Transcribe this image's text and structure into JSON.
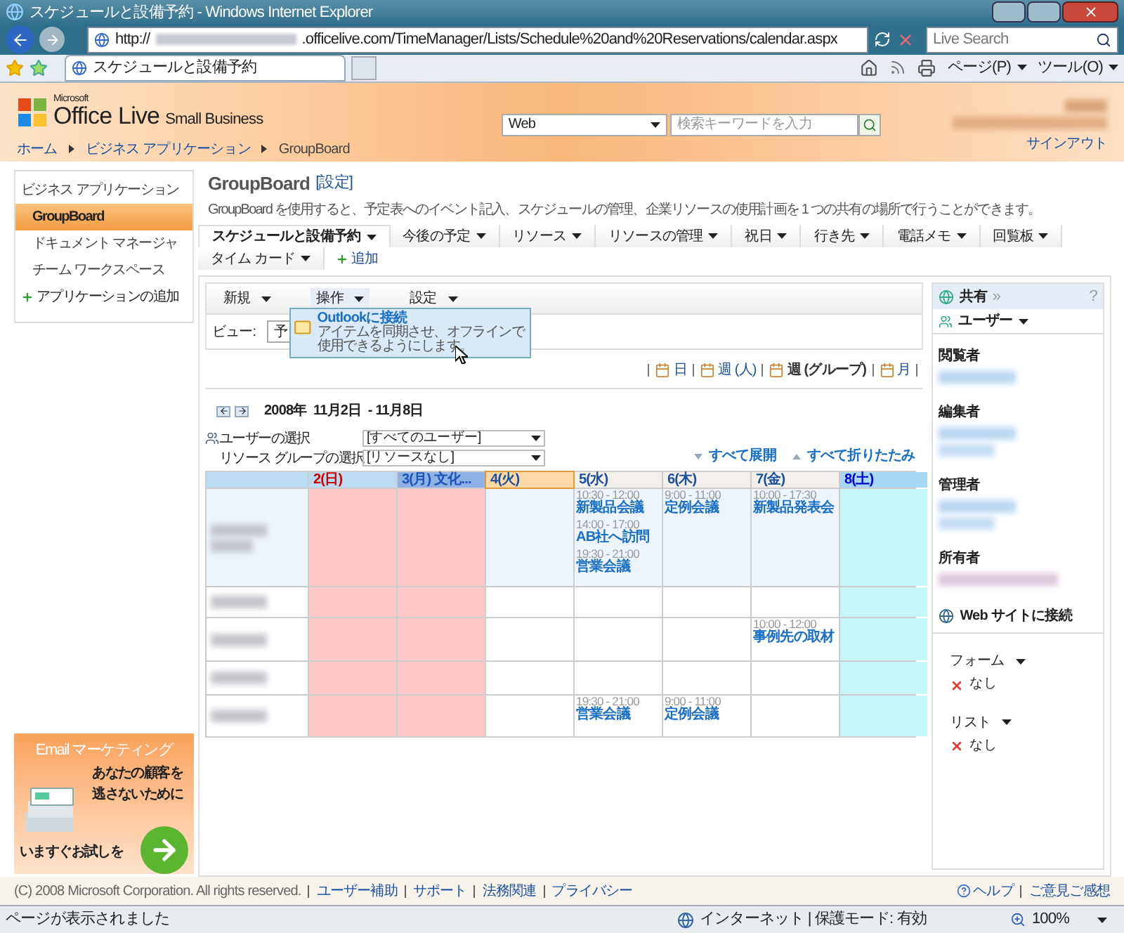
{
  "browser": {
    "title": "スケジュールと設備予約 - Windows Internet Explorer",
    "url_prefix": "http://",
    "url_rest": ".officelive.com/TimeManager/Lists/Schedule%20and%20Reservations/calendar.aspx",
    "search_placeholder": "Live Search",
    "tab": "スケジュールと設備予約",
    "commands": [
      "ページ(P)",
      "ツール(O)"
    ]
  },
  "header": {
    "logo_small": "Microsoft",
    "logo_main": "Office Live",
    "logo_sub": "Small Business",
    "search_scope": "Web",
    "search_placeholder": "検索キーワードを入力",
    "signout": "サインアウト",
    "breadcrumb": [
      "ホーム",
      "ビジネス アプリケーション",
      "GroupBoard"
    ]
  },
  "sidebar": {
    "heading": "ビジネス アプリケーション",
    "items": [
      {
        "label": "GroupBoard",
        "selected": true
      },
      {
        "label": "ドキュメント マネージャ",
        "selected": false
      },
      {
        "label": "チーム ワークスペース",
        "selected": false
      }
    ],
    "add": "アプリケーションの追加",
    "ad": {
      "title": "Email マーケティング",
      "lines": [
        "あなたの顧客を",
        "逃さないために"
      ],
      "cta": "いますぐお試しを"
    }
  },
  "page": {
    "title": "GroupBoard",
    "settings_link": "[設定]",
    "description": "GroupBoard を使用すると、予定表へのイベント記入、スケジュールの管理、企業リソースの使用計画を 1 つの共有の場所で行うことができます。",
    "tabs": [
      [
        {
          "label": "スケジュールと設備予約",
          "selected": true
        },
        {
          "label": "今後の予定",
          "selected": false
        },
        {
          "label": "リソース",
          "selected": false
        },
        {
          "label": "リソースの管理",
          "selected": false
        },
        {
          "label": "祝日",
          "selected": false
        },
        {
          "label": "行き先",
          "selected": false
        },
        {
          "label": "電話メモ",
          "selected": false
        },
        {
          "label": "回覧板",
          "selected": false
        }
      ],
      [
        {
          "label": "タイム カード",
          "selected": false
        }
      ]
    ],
    "add_tab": "追加",
    "toolbar": [
      {
        "label": "新規",
        "open": false
      },
      {
        "label": "操作",
        "open": true
      },
      {
        "label": "設定",
        "open": false
      }
    ],
    "menu": {
      "title": "Outlookに接続",
      "description": "アイテムを同期させ、オフラインで使用できるようにします。"
    },
    "view_label": "ビュー:",
    "view_value": "予",
    "views": [
      {
        "label": "日",
        "selected": false
      },
      {
        "label": "週 (人)",
        "selected": false
      },
      {
        "label": "週 (グループ)",
        "selected": true
      },
      {
        "label": "月",
        "selected": false
      }
    ],
    "date_range": "2008年  11月2日  - 11月8日",
    "filters": [
      {
        "label": "ユーザーの選択",
        "value": "[すべてのユーザー]"
      },
      {
        "label": "リソース グループの選択",
        "value": "[リソースなし]"
      }
    ],
    "expand_all": "すべて展開",
    "collapse_all": "すべて折りたたみ",
    "days": [
      {
        "label": "2(日)",
        "kind": "sunday"
      },
      {
        "label": "3(月) 文化...",
        "kind": "holiday"
      },
      {
        "label": "4(火)",
        "kind": "today"
      },
      {
        "label": "5(水)",
        "kind": "weekday"
      },
      {
        "label": "6(木)",
        "kind": "weekday"
      },
      {
        "label": "7(金)",
        "kind": "weekday"
      },
      {
        "label": "8(土)",
        "kind": "saturday"
      }
    ],
    "rows": [
      {
        "selected": true,
        "cells": [
          [],
          [],
          [],
          [
            {
              "time": "10:30 - 12:00",
              "title": "新製品会議"
            },
            {
              "time": "14:00 - 17:00",
              "title": "AB社へ訪問"
            },
            {
              "time": "19:30 - 21:00",
              "title": "営業会議"
            }
          ],
          [
            {
              "time": "9:00 - 11:00",
              "title": "定例会議"
            }
          ],
          [
            {
              "time": "10:00 - 17:30",
              "title": "新製品発表会"
            }
          ],
          []
        ]
      },
      {
        "selected": false,
        "cells": [
          [],
          [],
          [],
          [],
          [],
          [],
          []
        ]
      },
      {
        "selected": false,
        "cells": [
          [],
          [],
          [],
          [],
          [],
          [
            {
              "time": "10:00 - 12:00",
              "title": "事例先の取材"
            }
          ],
          []
        ]
      },
      {
        "selected": false,
        "cells": [
          [],
          [],
          [],
          [],
          [],
          [],
          []
        ]
      },
      {
        "selected": false,
        "cells": [
          [],
          [],
          [],
          [
            {
              "time": "19:30 - 21:00",
              "title": "営業会議"
            }
          ],
          [
            {
              "time": "9:00 - 11:00",
              "title": "定例会議"
            }
          ],
          [],
          []
        ]
      }
    ]
  },
  "share": {
    "title": "共有",
    "collapse": "»",
    "help": "?",
    "users_menu": "ユーザー",
    "roles": [
      "閲覧者",
      "編集者",
      "管理者",
      "所有者"
    ],
    "connect": "Web サイトに接続",
    "lists": [
      {
        "label": "フォーム",
        "value": "なし"
      },
      {
        "label": "リスト",
        "value": "なし"
      }
    ]
  },
  "footer": {
    "copyright": "(C) 2008 Microsoft Corporation. All rights reserved.",
    "links": [
      "ユーザー補助",
      "サポート",
      "法務関連",
      "プライバシー"
    ],
    "right_links": [
      "ヘルプ",
      "ご意見ご感想"
    ]
  },
  "status": {
    "text": "ページが表示されました",
    "zone": "インターネット | 保護モード: 有効",
    "zoom": "100%"
  }
}
